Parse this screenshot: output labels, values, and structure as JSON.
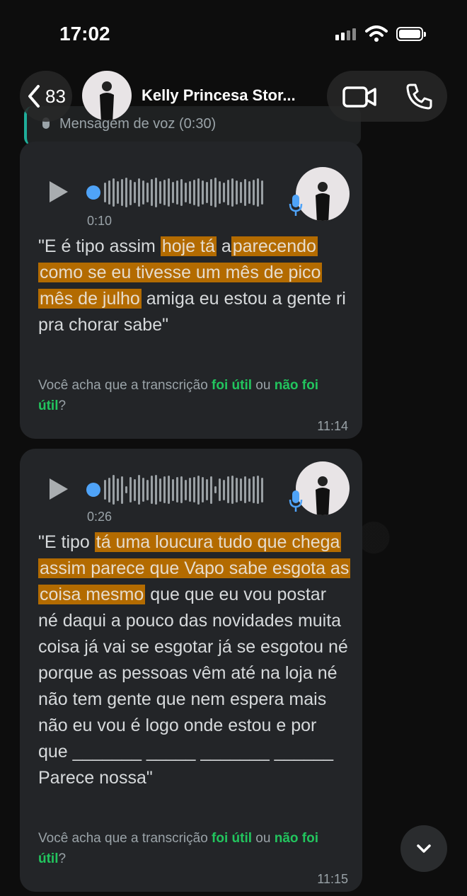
{
  "status_bar": {
    "time": "17:02",
    "icons": [
      "signal-icon",
      "wifi-icon",
      "battery-icon"
    ]
  },
  "header": {
    "back_count": "83",
    "contact_name": "Kelly Princesa Stor...",
    "icons": [
      "chevron-left-icon",
      "video-call-icon",
      "phone-call-icon"
    ]
  },
  "quoted_preview": {
    "text": "Mensagem de voz (0:30)"
  },
  "messages": [
    {
      "duration": "0:10",
      "transcript_parts": {
        "p1": "\"E é tipo assim ",
        "h1": "hoje tá",
        "p2": " a",
        "h2": "parecendo como se eu tivesse um mês de pico mês de julho",
        "p3": " amiga eu estou a gente ri pra chorar sabe\""
      },
      "feedback": {
        "prefix": "Você acha que a transcrição ",
        "useful": "foi útil",
        "middle": " ou ",
        "not_useful": "não foi útil",
        "suffix": "?"
      },
      "time": "11:14"
    },
    {
      "duration": "0:26",
      "transcript_parts": {
        "p1": "\"E tipo ",
        "h1": "tá uma loucura tudo que chega assim parece que Vapo sabe esgota as coisa mesmo",
        "p2": " que que eu vou postar né daqui a pouco das novidades muita coisa já vai se esgotar já se esgotou né porque as pessoas vêm até na loja né não tem gente que nem espera mais não eu vou é logo onde estou e por que _______ _____ _______ ______ Parece nossa\""
      },
      "feedback": {
        "prefix": "Você acha que a transcrição ",
        "useful": "foi útil",
        "middle": " ou ",
        "not_useful": "não foi útil",
        "suffix": "?"
      },
      "time": "11:15"
    }
  ],
  "colors": {
    "bubble": "#232528",
    "highlight": "#b36b00",
    "green_link": "#22c55e",
    "waveform_dot": "#4fa3f7",
    "mic_blue": "#4fa3f7"
  }
}
